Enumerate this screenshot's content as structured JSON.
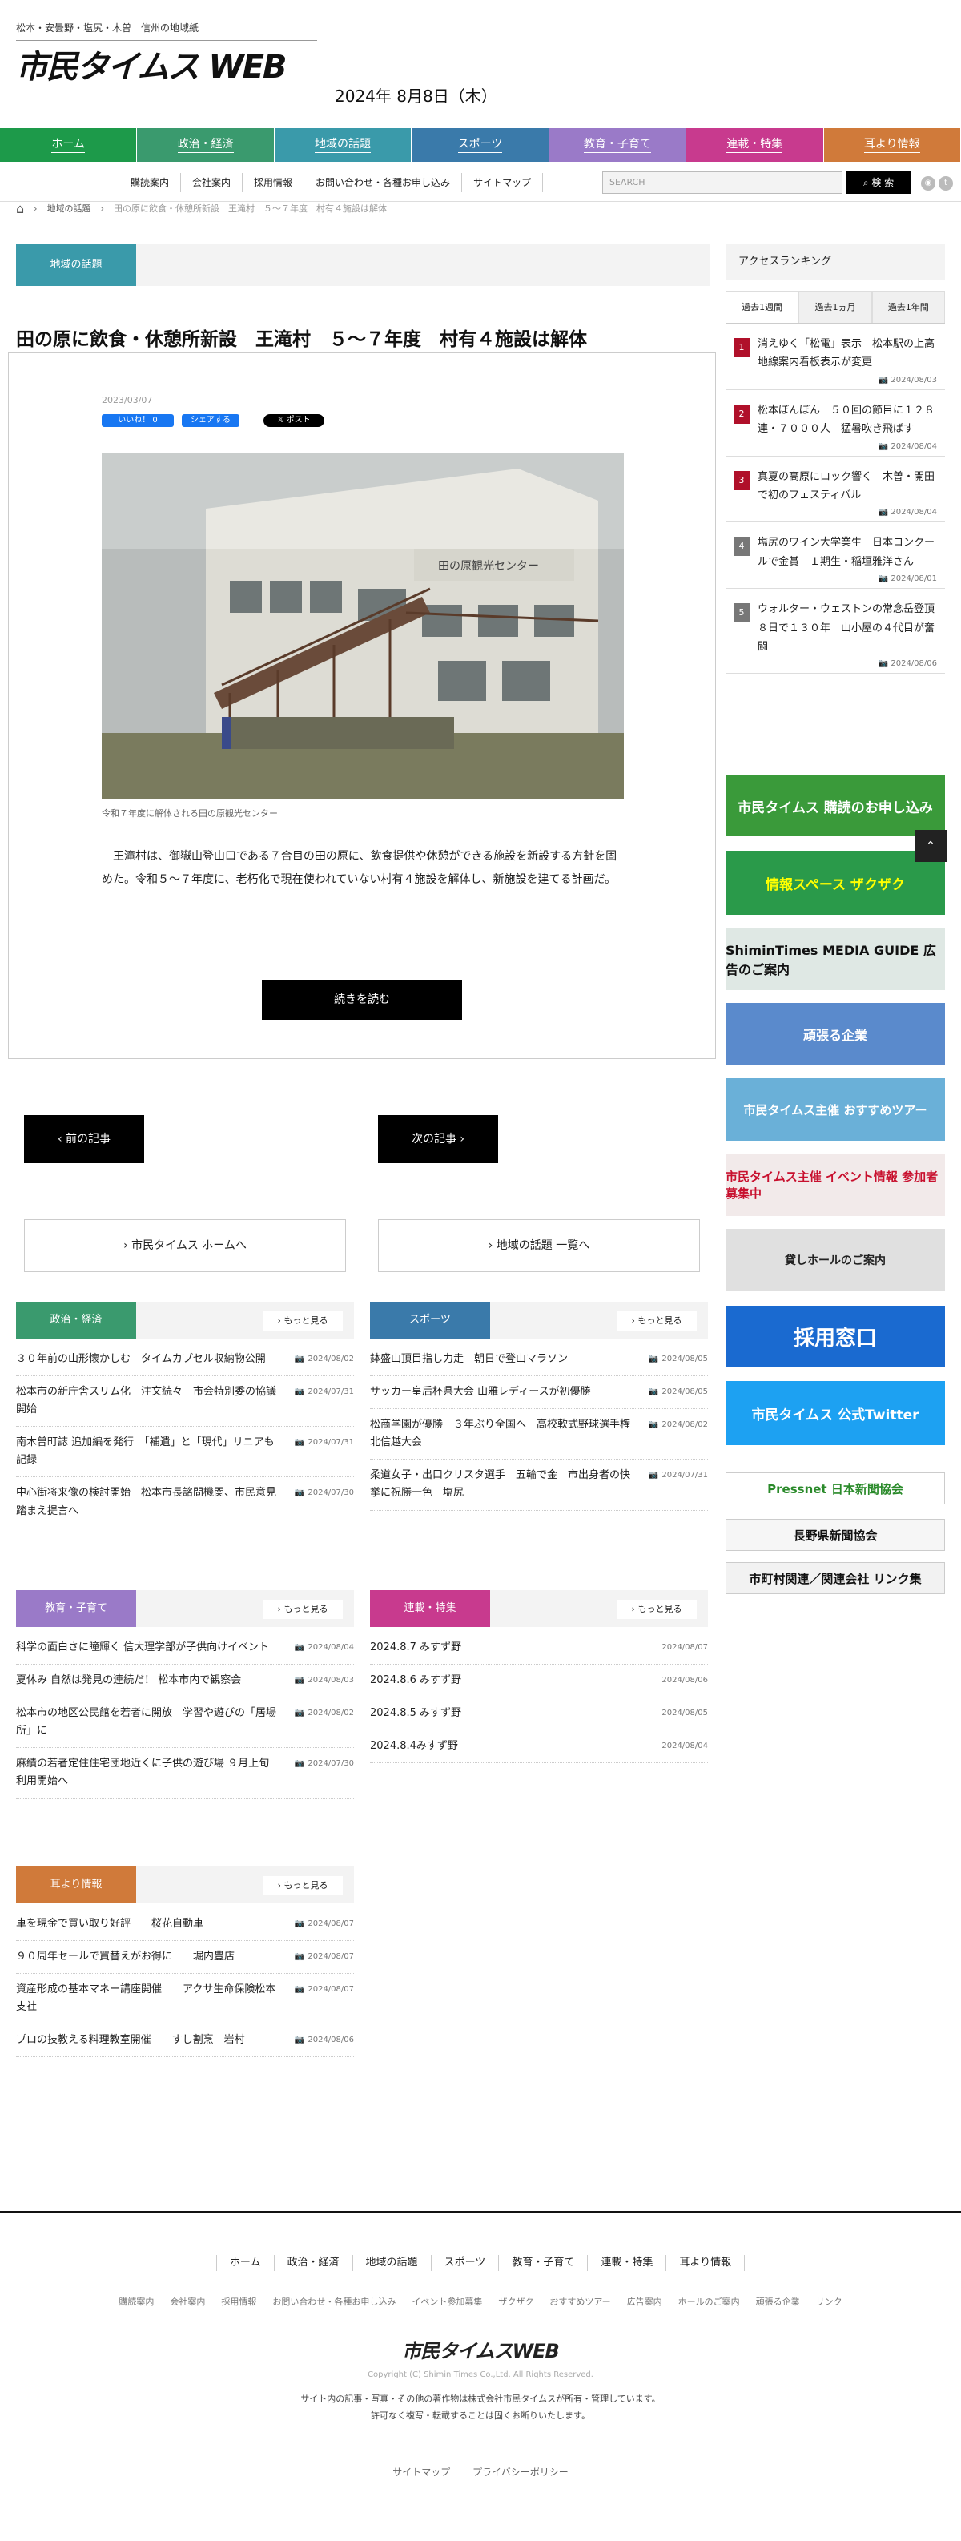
{
  "header": {
    "tagline": "松本・安曇野・塩尻・木曽　信州の地域紙",
    "logo_main": "市民タイムス",
    "logo_web": "WEB",
    "date": "2024年 8月8日（木）"
  },
  "gnav": [
    {
      "label": "ホーム",
      "color": "#1d9a4a"
    },
    {
      "label": "政治・経済",
      "color": "#3a9a6e"
    },
    {
      "label": "地域の話題",
      "color": "#3a9aaa"
    },
    {
      "label": "スポーツ",
      "color": "#3a7aaa"
    },
    {
      "label": "教育・子育て",
      "color": "#9a7ac8"
    },
    {
      "label": "連載・特集",
      "color": "#c83a8e"
    },
    {
      "label": "耳より情報",
      "color": "#d07a3a"
    }
  ],
  "subnav": [
    "購読案内",
    "会社案内",
    "採用情報",
    "お問い合わせ・各種お申し込み",
    "サイトマップ"
  ],
  "search": {
    "placeholder": "SEARCH",
    "button": "検 索"
  },
  "breadcrumb": {
    "level1": "地域の話題",
    "current": "田の原に飲食・休憩所新設　王滝村　５～７年度　村有４施設は解体"
  },
  "article": {
    "category": "地域の話題",
    "title": "田の原に飲食・休憩所新設　王滝村　５～７年度　村有４施設は解体",
    "date": "2023/03/07",
    "fb_like": "いいね！ 0",
    "fb_share": "シェアする",
    "x_post": "ポスト",
    "photo_sign": "田の原観光センター",
    "caption": "令和７年度に解体される田の原観光センター",
    "body": "王滝村は、御嶽山登山口である７合目の田の原に、飲食提供や休憩ができる施設を新設する方針を固めた。令和５～７年度に、老朽化で現在使われていない村有４施設を解体し、新施設を建てる計画だ。",
    "read_more": "続きを読む",
    "prev": "前の記事",
    "next": "次の記事",
    "home_link": "市民タイムス ホームへ",
    "list_link": "地域の話題 一覧へ"
  },
  "sections": [
    {
      "title": "政治・経済",
      "color": "#3a9a6e",
      "more": "もっと見る",
      "items": [
        {
          "t": "３０年前の山形懐かしむ　タイムカプセル収納物公開",
          "d": "2024/08/02"
        },
        {
          "t": "松本市の新庁舎スリム化　注文続々　市会特別委の協議開始",
          "d": "2024/07/31"
        },
        {
          "t": "南木曽町誌 追加編を発行　「補遺」と「現代」リニアも記録",
          "d": "2024/07/31"
        },
        {
          "t": "中心街将来像の検討開始　松本市長諮問機関、市民意見踏まえ提言へ",
          "d": "2024/07/30"
        }
      ]
    },
    {
      "title": "スポーツ",
      "color": "#3a7aaa",
      "more": "もっと見る",
      "items": [
        {
          "t": "鉢盛山頂目指し力走　朝日で登山マラソン",
          "d": "2024/08/05"
        },
        {
          "t": "サッカー皇后杯県大会 山雅レディースが初優勝",
          "d": "2024/08/05"
        },
        {
          "t": "松商学園が優勝　３年ぶり全国へ　高校軟式野球選手権北信越大会",
          "d": "2024/08/02"
        },
        {
          "t": "柔道女子・出口クリスタ選手　五輪で金　市出身者の快挙に祝勝一色　塩尻",
          "d": "2024/07/31"
        }
      ]
    },
    {
      "title": "教育・子育て",
      "color": "#9a7ac8",
      "more": "もっと見る",
      "items": [
        {
          "t": "科学の面白さに瞳輝く 信大理学部が子供向けイベント",
          "d": "2024/08/04"
        },
        {
          "t": "夏休み 自然は発見の連続だ！ 松本市内で観察会",
          "d": "2024/08/03"
        },
        {
          "t": "松本市の地区公民館を若者に開放　学習や遊びの「居場所」に",
          "d": "2024/08/02"
        },
        {
          "t": "麻績の若者定住住宅団地近くに子供の遊び場 ９月上旬利用開始へ",
          "d": "2024/07/30"
        }
      ]
    },
    {
      "title": "連載・特集",
      "color": "#c83a8e",
      "more": "もっと見る",
      "items": [
        {
          "t": "2024.8.7 みすず野",
          "d": "2024/08/07"
        },
        {
          "t": "2024.8.6 みすず野",
          "d": "2024/08/06"
        },
        {
          "t": "2024.8.5 みすず野",
          "d": "2024/08/05"
        },
        {
          "t": "2024.8.4みすず野",
          "d": "2024/08/04"
        }
      ]
    },
    {
      "title": "耳より情報",
      "color": "#d07a3a",
      "more": "もっと見る",
      "items": [
        {
          "t": "車を現金で買い取り好評　　桜花自動車",
          "d": "2024/08/07"
        },
        {
          "t": "９０周年セールで買替えがお得に　　堀内豊店",
          "d": "2024/08/07"
        },
        {
          "t": "資産形成の基本マネー講座開催　　アクサ生命保険松本支社",
          "d": "2024/08/07"
        },
        {
          "t": "プロの技教える料理教室開催　　すし割烹　岩村",
          "d": "2024/08/06"
        }
      ]
    }
  ],
  "ranking": {
    "title": "アクセスランキング",
    "tabs": [
      "過去1週間",
      "過去1ヵ月",
      "過去1年間"
    ],
    "items": [
      {
        "n": "1",
        "t": "消えゆく「松電」表示　松本駅の上高地線案内看板表示が変更",
        "d": "2024/08/03",
        "c": "#b0102a"
      },
      {
        "n": "2",
        "t": "松本ぼんぼん　５０回の節目に１２８連・７０００人　猛暑吹き飛ばす",
        "d": "2024/08/04",
        "c": "#b0102a"
      },
      {
        "n": "3",
        "t": "真夏の高原にロック響く　木曽・開田で初のフェスティバル",
        "d": "2024/08/04",
        "c": "#b0102a"
      },
      {
        "n": "4",
        "t": "塩尻のワイン大学業生　日本コンクールで金賞　１期生・稲垣雅洋さん",
        "d": "2024/08/01",
        "c": "#777777"
      },
      {
        "n": "5",
        "t": "ウォルター・ウェストンの常念岳登頂８日で１３０年　山小屋の４代目が奮闘",
        "d": "2024/08/06",
        "c": "#777777"
      }
    ]
  },
  "banners": [
    "市民タイムス 購読のお申し込み",
    "情報スペース ザクザク",
    "ShiminTimes MEDIA GUIDE 広告のご案内",
    "頑張る企業",
    "市民タイムス主催 おすすめツアー",
    "市民タイムス主催 イベント情報 参加者募集中",
    "貸しホールのご案内",
    "採用窓口",
    "市民タイムス 公式Twitter",
    "Pressnet 日本新聞協会",
    "長野県新聞協会",
    "市町村関連／関連会社 リンク集"
  ],
  "footer": {
    "nav": [
      "ホーム",
      "政治・経済",
      "地域の話題",
      "スポーツ",
      "教育・子育て",
      "連載・特集",
      "耳より情報"
    ],
    "nav2": [
      "購読案内",
      "会社案内",
      "採用情報",
      "お問い合わせ・各種お申し込み",
      "イベント参加募集",
      "ザクザク",
      "おすすめツアー",
      "広告案内",
      "ホールのご案内",
      "頑張る企業",
      "リンク"
    ],
    "logo": "市民タイムスWEB",
    "copyright": "Copyright (C) Shimin Times Co.,Ltd. All Rights Reserved.",
    "rights1": "サイト内の記事・写真・その他の著作物は株式会社市民タイムスが所有・管理しています。",
    "rights2": "許可なく複写・転載することは固くお断りいたします。",
    "sitemap": "サイトマップ",
    "privacy": "プライバシーポリシー"
  }
}
